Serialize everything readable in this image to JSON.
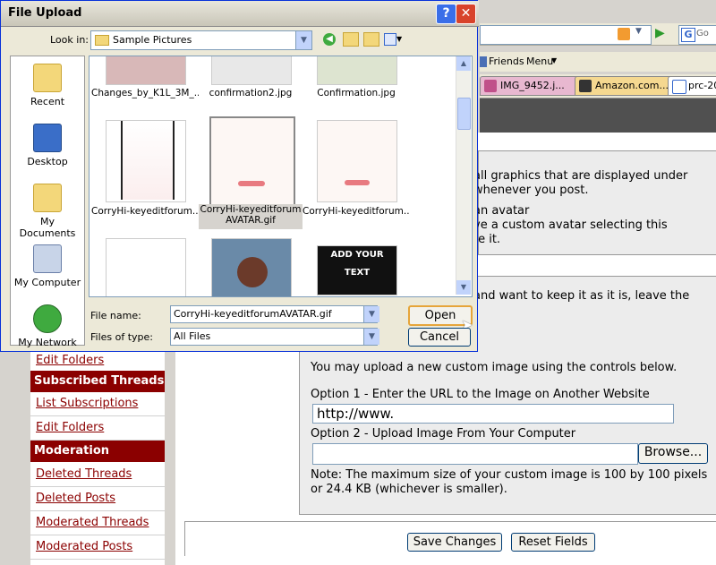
{
  "dialog": {
    "title": "File Upload",
    "help_label": "?",
    "close_label": "✕",
    "look_in_label": "Look in:",
    "look_in_value": "Sample Pictures",
    "places": [
      "Recent",
      "Desktop",
      "My Documents",
      "My Computer",
      "My Network"
    ],
    "files": [
      {
        "name": "Changes_by_K1L_3M_...",
        "selected": false
      },
      {
        "name": "confirmation2.jpg",
        "selected": false
      },
      {
        "name": "Confirmation.jpg",
        "selected": false
      },
      {
        "name": "CorryHi-keyeditforum...",
        "selected": false
      },
      {
        "name": "CorryHi-keyeditforumAVATAR.gif",
        "selected": true
      },
      {
        "name": "CorryHi-keyeditforum...",
        "selected": false
      }
    ],
    "thumb_text": "ADD YOUR TEXT",
    "file_name_label": "File name:",
    "file_name_value": "CorryHi-keyeditforumAVATAR.gif",
    "files_of_type_label": "Files of type:",
    "files_of_type_value": "All Files",
    "open_label": "Open",
    "cancel_label": "Cancel"
  },
  "browser": {
    "search_text": "Go",
    "links": [
      "Friends",
      "Menu"
    ],
    "tabs": [
      {
        "label": "IMG_9452.j...",
        "color": "#e2a8c8"
      },
      {
        "label": "Amazon.com...",
        "color": "#f0c060"
      },
      {
        "label": "prc-20",
        "color": "#ffffff"
      }
    ]
  },
  "sidebar": {
    "items": [
      {
        "kind": "link",
        "label": "Edit Folders"
      },
      {
        "kind": "head",
        "label": "Subscribed Threads"
      },
      {
        "kind": "link",
        "label": "List Subscriptions"
      },
      {
        "kind": "link",
        "label": "Edit Folders"
      },
      {
        "kind": "head",
        "label": "Moderation"
      },
      {
        "kind": "link",
        "label": "Deleted Threads"
      },
      {
        "kind": "link",
        "label": "Deleted Posts"
      },
      {
        "kind": "link",
        "label": "Moderated Threads"
      },
      {
        "kind": "link",
        "label": "Moderated Posts"
      }
    ]
  },
  "content": {
    "avatar_text_1": "all graphics that are displayed under",
    "avatar_text_2": "whenever you post.",
    "avatar_text_3": "an avatar",
    "avatar_text_4": "ve a custom avatar selecting this",
    "avatar_text_5": "te it.",
    "keep_text": "and want to keep it as it is, leave the",
    "upload_intro": "You may upload a new custom image using the controls below.",
    "option1_label": "Option 1 - Enter the URL to the Image on Another Website",
    "url_value": "http://www.",
    "option2_label": "Option 2 - Upload Image From Your Computer",
    "browse_label": "Browse...",
    "note_1": "Note: The maximum size of your custom image is 100 by 100 pixels",
    "note_2": "or 24.4 KB (whichever is smaller).",
    "save_label": "Save Changes",
    "reset_label": "Reset Fields"
  },
  "colors": {
    "accent": "#8b0000",
    "title_close": "#d8432b",
    "title_help": "#3a6ee8"
  }
}
